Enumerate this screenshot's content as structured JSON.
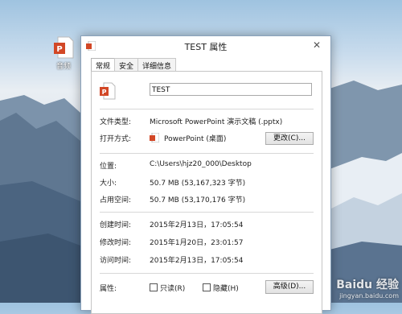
{
  "desktop": {
    "icon_label": "音频"
  },
  "window": {
    "title": "TEST 属性",
    "close": "✕",
    "tabs": [
      "常规",
      "安全",
      "详细信息"
    ],
    "file_name": "TEST",
    "rows": {
      "type_label": "文件类型:",
      "type_value": "Microsoft PowerPoint 演示文稿 (.pptx)",
      "open_label": "打开方式:",
      "open_value": "PowerPoint (桌面)",
      "change_button": "更改(C)...",
      "location_label": "位置:",
      "location_value": "C:\\Users\\hjz20_000\\Desktop",
      "size_label": "大小:",
      "size_value": "50.7 MB (53,167,323 字节)",
      "disk_label": "占用空间:",
      "disk_value": "50.7 MB (53,170,176 字节)",
      "created_label": "创建时间:",
      "created_value": "2015年2月13日，17:05:54",
      "modified_label": "修改时间:",
      "modified_value": "2015年1月20日，23:01:57",
      "accessed_label": "访问时间:",
      "accessed_value": "2015年2月13日，17:05:54",
      "attributes_label": "属性:",
      "readonly_label": "只读(R)",
      "hidden_label": "隐藏(H)",
      "advanced_button": "高级(D)..."
    }
  },
  "watermark": {
    "text": "Baidu 经验",
    "url": "jingyan.baidu.com"
  },
  "colors": {
    "ppt_orange": "#d24726",
    "window_border": "#8aa2bb"
  }
}
